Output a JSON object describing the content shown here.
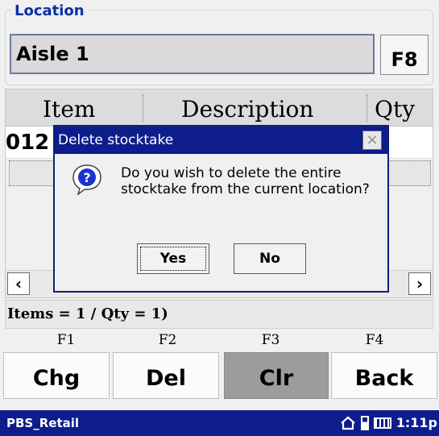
{
  "location": {
    "group_label": "Location",
    "value": "Aisle 1",
    "lookup_button": "F8"
  },
  "grid": {
    "columns": [
      "Item",
      "Description",
      "Qty"
    ],
    "rows": [
      {
        "item_visible": "012"
      }
    ]
  },
  "status": {
    "text": "Items = 1 / Qty = 1)"
  },
  "function_keys": [
    {
      "key": "F1",
      "label": "Chg"
    },
    {
      "key": "F2",
      "label": "Del"
    },
    {
      "key": "F3",
      "label": "Clr"
    },
    {
      "key": "F4",
      "label": "Back"
    }
  ],
  "taskbar": {
    "title": "PBS_Retail",
    "time": "1:11p",
    "icons": [
      "home-icon",
      "battery-icon",
      "keyboard-icon"
    ]
  },
  "dialog": {
    "title": "Delete stocktake",
    "message": "Do you wish to delete the entire stocktake from the current location?",
    "icon": "question-icon",
    "yes_label": "Yes",
    "no_label": "No"
  },
  "colors": {
    "title_bar": "#0d1d8c",
    "group_label": "#0a30a8",
    "pressed_key": "#9c9c9c"
  }
}
